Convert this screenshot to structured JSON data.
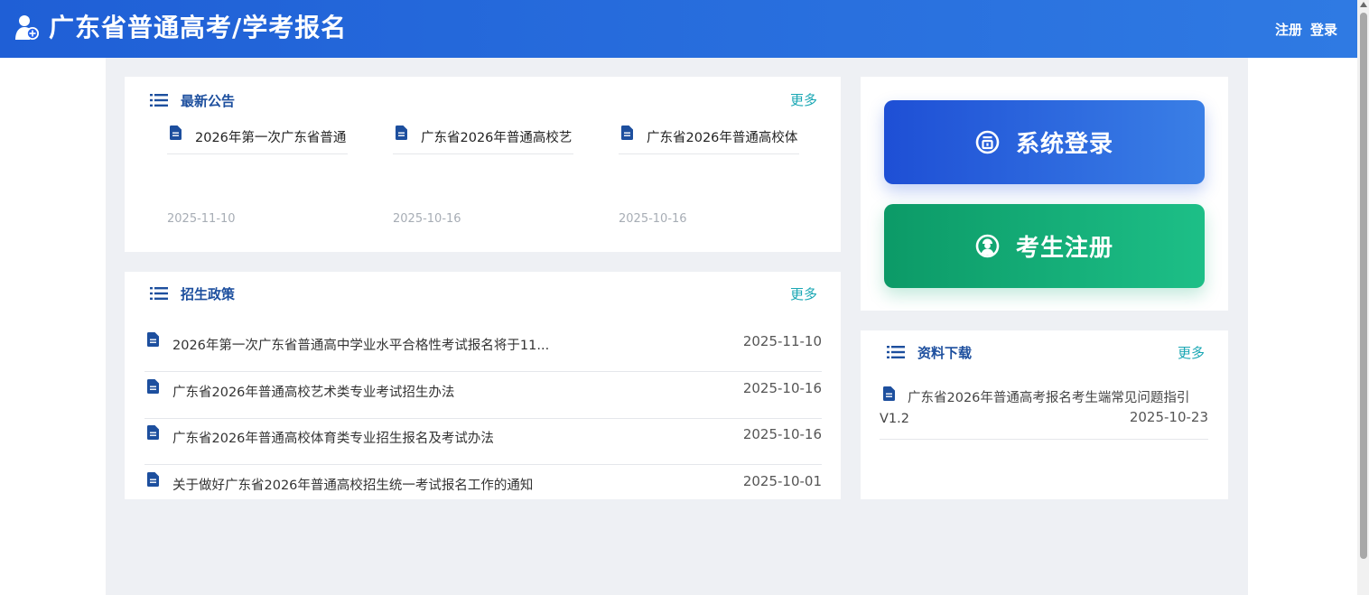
{
  "header": {
    "title": "广东省普通高考/学考报名",
    "register_link": "注册",
    "login_link": "登录"
  },
  "announcements": {
    "title": "最新公告",
    "more": "更多",
    "items": [
      {
        "title": "2026年第一次广东省普通",
        "date": "2025-11-10"
      },
      {
        "title": "广东省2026年普通高校艺",
        "date": "2025-10-16"
      },
      {
        "title": "广东省2026年普通高校体",
        "date": "2025-10-16"
      }
    ]
  },
  "policy": {
    "title": "招生政策",
    "more": "更多",
    "items": [
      {
        "title": "2026年第一次广东省普通高中学业水平合格性考试报名将于11...",
        "date": "2025-11-10"
      },
      {
        "title": "广东省2026年普通高校艺术类专业考试招生办法",
        "date": "2025-10-16"
      },
      {
        "title": "广东省2026年普通高校体育类专业招生报名及考试办法",
        "date": "2025-10-16"
      },
      {
        "title": "关于做好广东省2026年普通高校招生统一考试报名工作的通知",
        "date": "2025-10-01"
      }
    ]
  },
  "quick_actions": {
    "login_label": "系统登录",
    "register_label": "考生注册"
  },
  "downloads": {
    "title": "资料下载",
    "more": "更多",
    "items": [
      {
        "title": "广东省2026年普通高考报名考生端常见问题指引V1.2",
        "date": "2025-10-23"
      }
    ]
  },
  "colors": {
    "header_gradient_start": "#1f5fd6",
    "header_gradient_end": "#2f7ae3",
    "section_title": "#1d4f9e",
    "more_link": "#1aa7b4",
    "login_button": "#2563eb",
    "register_button": "#10b981",
    "page_background": "#eef0f4"
  },
  "icons": {
    "logo": "user-add-icon",
    "section": "list-icon",
    "document": "document-icon",
    "login": "login-icon",
    "register": "student-icon"
  }
}
